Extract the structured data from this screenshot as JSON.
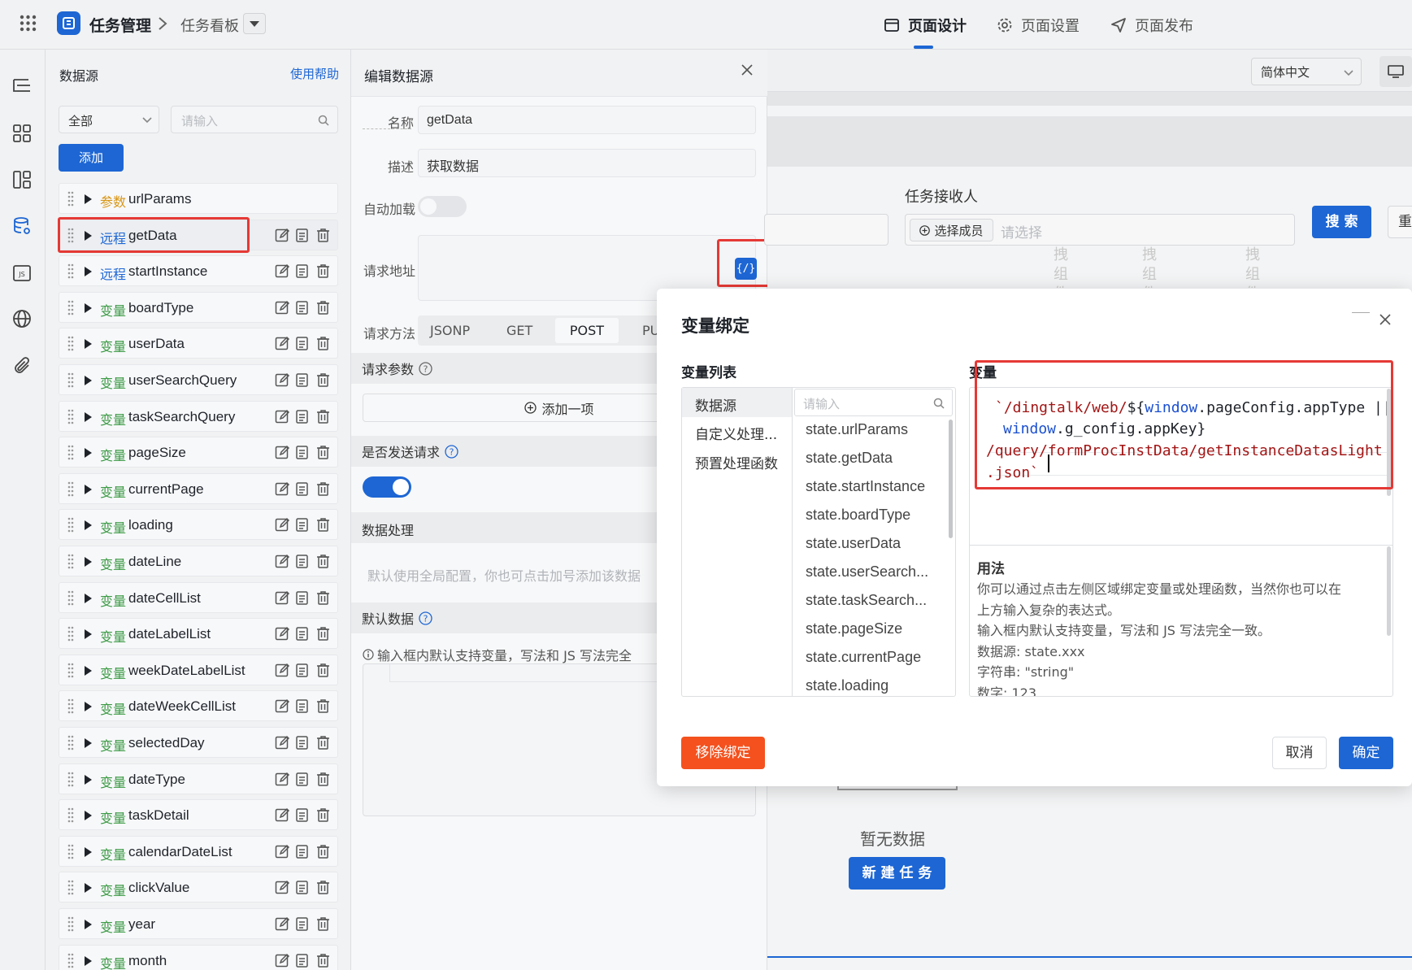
{
  "topbar": {
    "app_title": "任务管理",
    "breadcrumb_page": "任务看板",
    "tabs": [
      "页面设计",
      "页面设置",
      "页面发布"
    ],
    "accent": "#1d66d4"
  },
  "datasource_panel": {
    "title": "数据源",
    "help_link": "使用帮助",
    "filter_value": "全部",
    "search_placeholder": "请输入",
    "add_button": "添加",
    "items": [
      {
        "tag": "参数",
        "name": "urlParams",
        "kind": "param"
      },
      {
        "tag": "远程",
        "name": "getData",
        "kind": "remote"
      },
      {
        "tag": "远程",
        "name": "startInstance",
        "kind": "remote"
      },
      {
        "tag": "变量",
        "name": "boardType",
        "kind": "var"
      },
      {
        "tag": "变量",
        "name": "userData",
        "kind": "var"
      },
      {
        "tag": "变量",
        "name": "userSearchQuery",
        "kind": "var"
      },
      {
        "tag": "变量",
        "name": "taskSearchQuery",
        "kind": "var"
      },
      {
        "tag": "变量",
        "name": "pageSize",
        "kind": "var"
      },
      {
        "tag": "变量",
        "name": "currentPage",
        "kind": "var"
      },
      {
        "tag": "变量",
        "name": "loading",
        "kind": "var"
      },
      {
        "tag": "变量",
        "name": "dateLine",
        "kind": "var"
      },
      {
        "tag": "变量",
        "name": "dateCellList",
        "kind": "var"
      },
      {
        "tag": "变量",
        "name": "dateLabelList",
        "kind": "var"
      },
      {
        "tag": "变量",
        "name": "weekDateLabelList",
        "kind": "var"
      },
      {
        "tag": "变量",
        "name": "dateWeekCellList",
        "kind": "var"
      },
      {
        "tag": "变量",
        "name": "selectedDay",
        "kind": "var"
      },
      {
        "tag": "变量",
        "name": "dateType",
        "kind": "var"
      },
      {
        "tag": "变量",
        "name": "taskDetail",
        "kind": "var"
      },
      {
        "tag": "变量",
        "name": "calendarDateList",
        "kind": "var"
      },
      {
        "tag": "变量",
        "name": "clickValue",
        "kind": "var"
      },
      {
        "tag": "变量",
        "name": "year",
        "kind": "var"
      },
      {
        "tag": "变量",
        "name": "month",
        "kind": "var"
      }
    ]
  },
  "edit_panel": {
    "title": "编辑数据源",
    "name_label": "名称",
    "name_value": "getData",
    "desc_label": "描述",
    "desc_value": "获取数据",
    "autoload_label": "自动加载",
    "url_label": "请求地址",
    "url_button": "{/}",
    "method_label": "请求方法",
    "methods": [
      "JSONP",
      "GET",
      "POST",
      "PU"
    ],
    "selected_method": "POST",
    "params_header": "请求参数",
    "add_item": "添加一项",
    "send_header": "是否发送请求",
    "process_header": "数据处理",
    "process_hint": "默认使用全局配置，你也可点击加号添加该数据",
    "default_header": "默认数据",
    "default_hint": "输入框内默认支持变量，写法和 JS 写法完全"
  },
  "canvas": {
    "locale": "简体中文",
    "receiver_label": "任务接收人",
    "select_member": "选择成员",
    "select_placeholder": "请选择",
    "search_button": "搜 索",
    "reset_button_partial": "重",
    "ghost_columns": [
      "拽组件",
      "拽组件",
      "拽组件"
    ],
    "empty_text": "暂无数据",
    "new_task_button": "新 建 任 务"
  },
  "modal": {
    "title": "变量绑定",
    "list_title": "变量列表",
    "var_title": "变量",
    "categories": [
      "数据源",
      "自定义处理...",
      "预置处理函数"
    ],
    "search_placeholder": "请输入",
    "variables": [
      "state.urlParams",
      "state.getData",
      "state.startInstance",
      "state.boardType",
      "state.userData",
      "state.userSearch...",
      "state.taskSearch...",
      "state.pageSize",
      "state.currentPage",
      "state.loading"
    ],
    "code_lines": [
      [
        {
          "t": "`/dingtalk/web/",
          "c": "str"
        },
        {
          "t": "${",
          "c": "plain"
        },
        {
          "t": "window",
          "c": "kw"
        },
        {
          "t": ".pageConfig.appType || ",
          "c": "plain"
        }
      ],
      [
        {
          "t": "window",
          "c": "kw"
        },
        {
          "t": ".g_config.appKey}",
          "c": "plain"
        }
      ],
      [
        {
          "t": "/query/formProcInstData/getInstanceDatasLight",
          "c": "str"
        }
      ],
      [
        {
          "t": ".json`",
          "c": "str"
        }
      ]
    ],
    "usage_title": "用法",
    "usage_lines": [
      "你可以通过点击左侧区域绑定变量或处理函数，当然你也可以在",
      "上方输入复杂的表达式。",
      "输入框内默认支持变量，写法和 JS 写法完全一致。",
      "数据源: state.xxx",
      "字符串: \"string\"",
      "数字: 123"
    ],
    "remove_button": "移除绑定",
    "cancel_button": "取消",
    "confirm_button": "确定"
  },
  "colors": {
    "primary": "#1d66d4",
    "danger": "#f4511e",
    "highlight": "#e53935",
    "param": "#d89614",
    "remote": "#1d66d4",
    "var": "#3c9a45"
  }
}
